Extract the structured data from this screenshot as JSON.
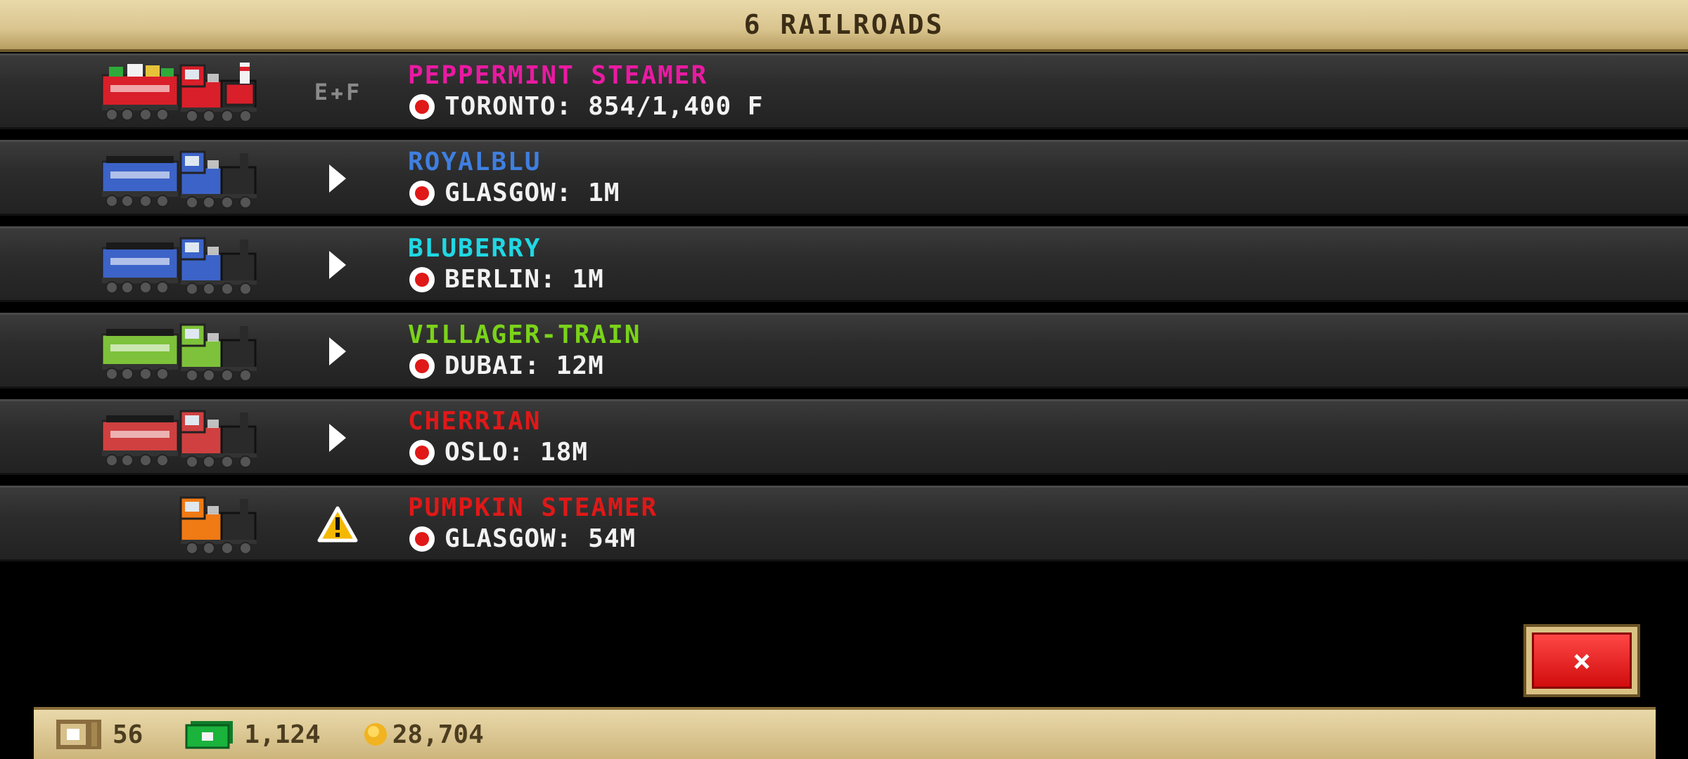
{
  "header": {
    "title": "6 RAILROADS"
  },
  "railroads": [
    {
      "name": "PEPPERMINT STEAMER",
      "name_color": "#ea1aa2",
      "location": "TORONTO: 854/1,400 F",
      "status": "ef-gauge",
      "status_label": "E",
      "status_label2": "F",
      "train_colors": [
        "#d91f2a",
        "#d91f2a"
      ],
      "tender": true,
      "train_theme": "christmas"
    },
    {
      "name": "ROYALBLU",
      "name_color": "#3f7fe0",
      "location": "GLASGOW: 1M",
      "status": "play-icon",
      "train_colors": [
        "#3c63c8",
        "#3c63c8"
      ],
      "tender": true
    },
    {
      "name": "BLUBERRY",
      "name_color": "#20d8e4",
      "location": "BERLIN: 1M",
      "status": "play-icon",
      "train_colors": [
        "#3c63c8",
        "#3c63c8"
      ],
      "tender": true
    },
    {
      "name": "VILLAGER-TRAIN",
      "name_color": "#7ad31a",
      "location": "DUBAI: 12M",
      "status": "play-icon",
      "train_colors": [
        "#7dc23a",
        "#7dc23a"
      ],
      "tender": true
    },
    {
      "name": "CHERRIAN",
      "name_color": "#e01818",
      "location": "OSLO: 18M",
      "status": "play-icon",
      "train_colors": [
        "#d04040",
        "#d04040"
      ],
      "tender": true
    },
    {
      "name": "PUMPKIN STEAMER",
      "name_color": "#e01818",
      "location": "GLASGOW: 54M",
      "status": "warning-icon",
      "train_colors": [
        "#f07a14",
        "#f07a14"
      ],
      "tender": false
    }
  ],
  "close_button": {
    "label": "×"
  },
  "footer": {
    "tickets": "56",
    "cash": "1,124",
    "coins": "28,704"
  }
}
